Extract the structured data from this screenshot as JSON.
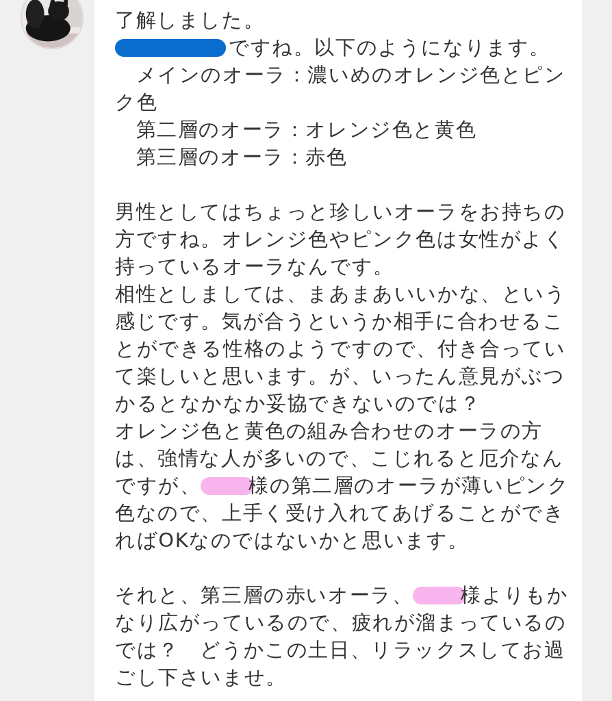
{
  "message": {
    "paragraphs": [
      {
        "lines": [
          [
            {
              "kind": "text",
              "text": "了解しました。"
            }
          ],
          [
            {
              "kind": "redaction",
              "color": "#0a6ccc"
            },
            {
              "kind": "text",
              "text": "ですね。以下のようになります。"
            }
          ],
          [
            {
              "kind": "text",
              "text": "　メインのオーラ：濃いめのオレンジ色とピン"
            }
          ],
          [
            {
              "kind": "text",
              "text": "ク色"
            }
          ],
          [
            {
              "kind": "text",
              "text": "　第二層のオーラ：オレンジ色と黄色"
            }
          ],
          [
            {
              "kind": "text",
              "text": "　第三層のオーラ：赤色"
            }
          ]
        ]
      },
      {
        "lines": [
          [
            {
              "kind": "text",
              "text": "男性としてはちょっと珍しいオーラをお持ちの"
            }
          ],
          [
            {
              "kind": "text",
              "text": "方ですね。オレンジ色やピンク色は女性がよく"
            }
          ],
          [
            {
              "kind": "text",
              "text": "持っているオーラなんです。"
            }
          ],
          [
            {
              "kind": "text",
              "text": "相性としましては、まあまあいいかな、という"
            }
          ],
          [
            {
              "kind": "text",
              "text": "感じです。気が合うというか相手に合わせるこ"
            }
          ],
          [
            {
              "kind": "text",
              "text": "とができる性格のようですので、付き合ってい"
            }
          ],
          [
            {
              "kind": "text",
              "text": "て楽しいと思います。が、いったん意見がぶつ"
            }
          ],
          [
            {
              "kind": "text",
              "text": "かるとなかなか妥協できないのでは？"
            }
          ],
          [
            {
              "kind": "text",
              "text": "オレンジ色と黄色の組み合わせのオーラの方"
            }
          ],
          [
            {
              "kind": "text",
              "text": "は、強情な人が多いので、こじれると厄介なん"
            }
          ],
          [
            {
              "kind": "text",
              "text": "ですが、"
            },
            {
              "kind": "redaction",
              "color": "#f8b4ec"
            },
            {
              "kind": "text",
              "text": "様の第二層のオーラが薄いピンク"
            }
          ],
          [
            {
              "kind": "text",
              "text": "色なので、上手く受け入れてあげることができ"
            }
          ],
          [
            {
              "kind": "text",
              "text": "ればOKなのではないかと思います。"
            }
          ]
        ]
      },
      {
        "lines": [
          [
            {
              "kind": "text",
              "text": "それと、第三層の赤いオーラ、"
            },
            {
              "kind": "redaction",
              "color": "#f8b4ec"
            },
            {
              "kind": "text",
              "text": "様よりもか"
            }
          ],
          [
            {
              "kind": "text",
              "text": "なり広がっているので、疲れが溜まっているの"
            }
          ],
          [
            {
              "kind": "text",
              "text": "では？　どうかこの土日、リラックスしてお過"
            }
          ],
          [
            {
              "kind": "text",
              "text": "ごし下さいませ。"
            }
          ]
        ]
      }
    ]
  }
}
